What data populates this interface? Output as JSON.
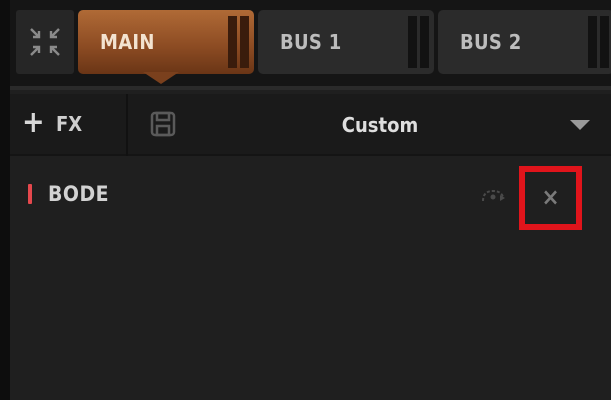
{
  "tabs_bar": {
    "collapse_icon": "collapse-arrows-icon",
    "tabs": [
      {
        "label": "MAIN",
        "active": true
      },
      {
        "label": "BUS 1",
        "active": false
      },
      {
        "label": "BUS 2",
        "active": false
      }
    ]
  },
  "fx_bar": {
    "add_plus": "+",
    "add_label": "FX",
    "save_icon": "save-icon",
    "preset_name": "Custom",
    "dropdown_icon": "dropdown-arrow-icon"
  },
  "fx_slots": [
    {
      "name": "BODE",
      "indicator_color": "#e5484d",
      "bypass_icon": "bypass-routing-icon",
      "remove_label": "×"
    }
  ],
  "colors": {
    "active_tab": "#a85f2f",
    "highlight_box": "#e0141b",
    "background": "#1f1f1f"
  }
}
